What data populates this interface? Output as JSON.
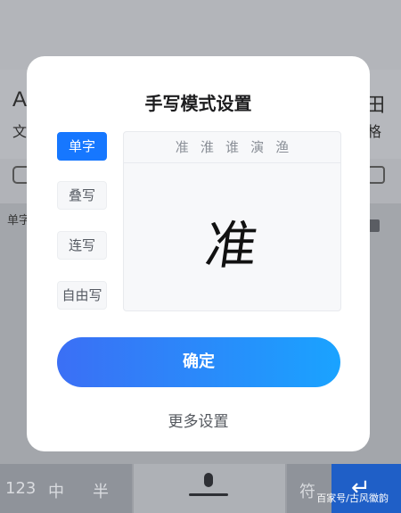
{
  "background": {
    "toolbar_left_glyph": "A",
    "toolbar_left_label": "文",
    "toolbar_right_glyph": "田",
    "toolbar_right_label": "格",
    "pad_label": "单字"
  },
  "keyboard": {
    "key_123": "123",
    "key_zh": "中",
    "key_half": "半",
    "key_symbol": "符",
    "enter_glyph": "↵",
    "watermark": "百家号/古风徽韵"
  },
  "dialog": {
    "title": "手写模式设置",
    "modes": [
      {
        "label": "单字",
        "active": true
      },
      {
        "label": "叠写",
        "active": false
      },
      {
        "label": "连写",
        "active": false
      },
      {
        "label": "自由写",
        "active": false
      }
    ],
    "candidates": [
      "准",
      "淮",
      "谁",
      "演",
      "渔"
    ],
    "handwriting_char": "准",
    "confirm_label": "确定",
    "more_label": "更多设置"
  },
  "colors": {
    "accent": "#1677ff",
    "confirm_gradient_start": "#3b6ff5",
    "confirm_gradient_end": "#1aa3ff"
  }
}
